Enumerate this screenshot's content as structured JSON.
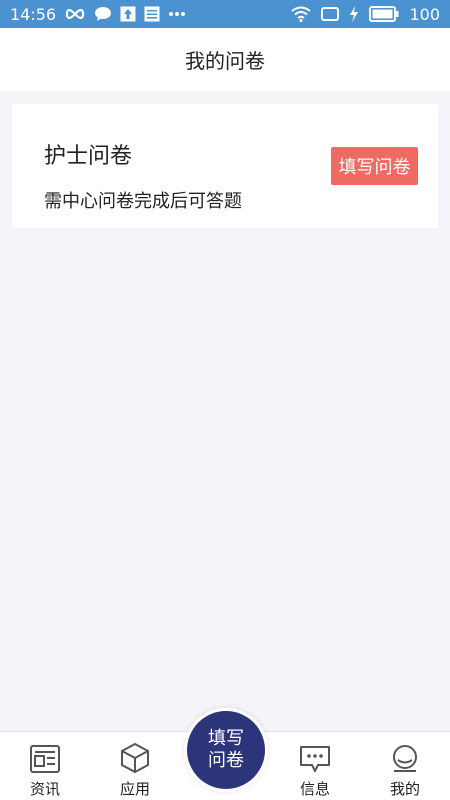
{
  "status_bar": {
    "time": "14:56",
    "battery": "100",
    "icons": [
      "infinity-icon",
      "chat-bubble-icon",
      "upload-icon",
      "news-icon",
      "more-icon",
      "wifi-icon",
      "screen-icon",
      "charging-icon",
      "battery-icon"
    ]
  },
  "header": {
    "title": "我的问卷"
  },
  "card": {
    "title": "护士问卷",
    "subtitle": "需中心问卷完成后可答题",
    "button_label": "填写问卷"
  },
  "tabbar": {
    "tabs": [
      {
        "label": "资讯",
        "icon": "news-icon"
      },
      {
        "label": "应用",
        "icon": "cube-icon"
      },
      {
        "label": "信息",
        "icon": "message-icon"
      },
      {
        "label": "我的",
        "icon": "profile-icon"
      }
    ],
    "center": {
      "line1": "填写",
      "line2": "问卷"
    }
  },
  "colors": {
    "status_bar": "#4b92d0",
    "accent_button": "#ee6b63",
    "center_button": "#2c357a",
    "background": "#f5f4f8"
  }
}
